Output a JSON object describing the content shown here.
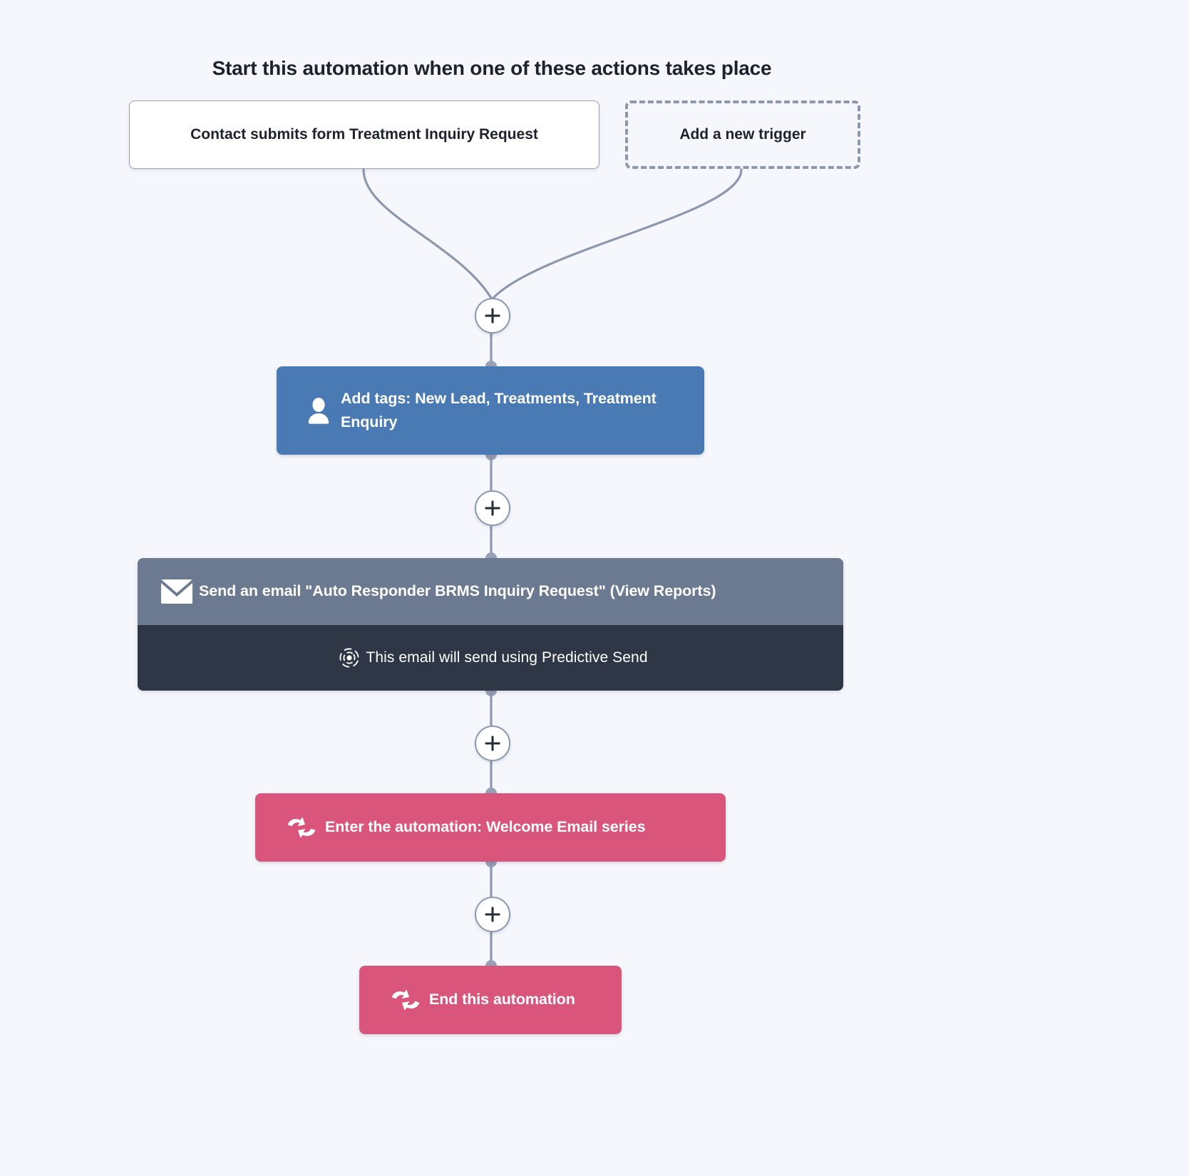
{
  "heading": "Start this automation when one of these actions takes place",
  "triggers": [
    {
      "label": "Contact submits form Treatment Inquiry Request",
      "style": "solid"
    },
    {
      "label": "Add a new trigger",
      "style": "dashed"
    }
  ],
  "add_buttons": [
    {
      "name": "add-step-after-triggers",
      "label": "+"
    },
    {
      "name": "add-step-after-add-tags",
      "label": "+"
    },
    {
      "name": "add-step-after-send-email",
      "label": "+"
    },
    {
      "name": "add-step-after-enter-automation",
      "label": "+"
    }
  ],
  "nodes": {
    "add_tags": {
      "label": "Add tags: New Lead, Treatments, Treatment Enquiry",
      "icon": "person-icon",
      "color": "#4a7ab4"
    },
    "send_email": {
      "label": "Send an email \"Auto Responder BRMS Inquiry Request\" (View Reports)",
      "icon": "envelope-icon",
      "color": "#6b7a91",
      "note_label": "This email will send using Predictive Send",
      "note_icon": "predictive-send-icon",
      "note_color": "#2f3646"
    },
    "enter_automation": {
      "label": "Enter the automation: Welcome Email series",
      "icon": "automation-arrows-icon",
      "color": "#d9557b"
    },
    "end_automation": {
      "label": "End this automation",
      "icon": "automation-arrows-icon",
      "color": "#d9557b"
    }
  },
  "colors": {
    "background": "#f5f7fc",
    "connector": "#8d97ad",
    "text_dark": "#1d222d"
  }
}
